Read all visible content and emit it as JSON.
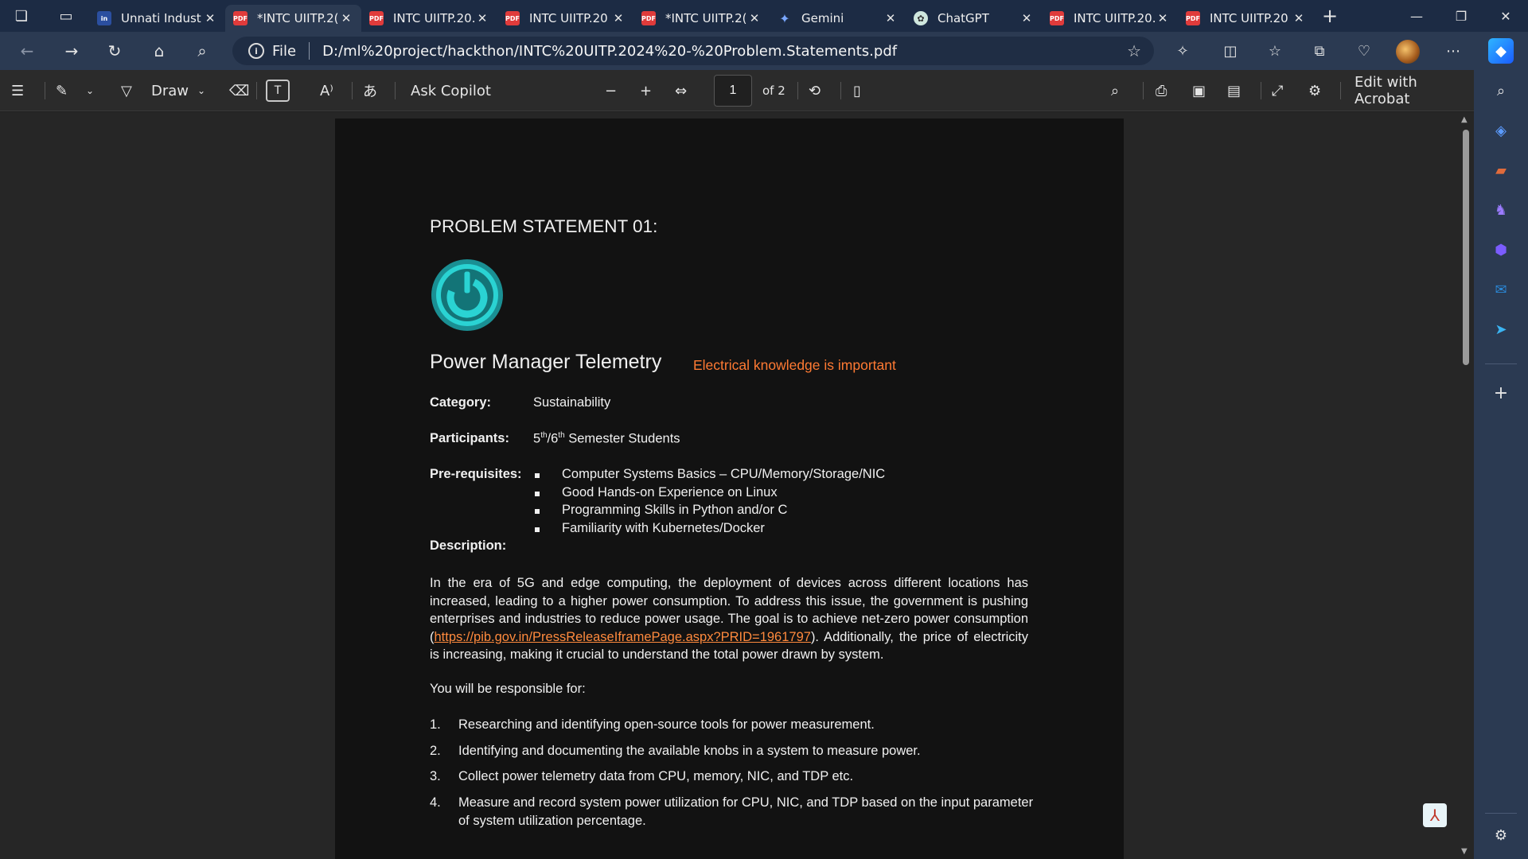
{
  "tabs": [
    {
      "title": "Unnati Indust",
      "favicon": "unnati-icon",
      "active": false
    },
    {
      "title": "*INTC UIITP.2(",
      "favicon": "pdf-icon",
      "active": true
    },
    {
      "title": "INTC UIITP.20.",
      "favicon": "pdf-icon",
      "active": false
    },
    {
      "title": "INTC UIITP.20",
      "favicon": "pdf-icon",
      "active": false
    },
    {
      "title": "*INTC UIITP.2(",
      "favicon": "pdf-icon",
      "active": false
    },
    {
      "title": "Gemini",
      "favicon": "gemini-icon",
      "active": false
    },
    {
      "title": "ChatGPT",
      "favicon": "chatgpt-icon",
      "active": false
    },
    {
      "title": "INTC UIITP.20.",
      "favicon": "pdf-icon",
      "active": false
    },
    {
      "title": "INTC UIITP.20",
      "favicon": "pdf-icon",
      "active": false
    }
  ],
  "address": {
    "scheme_label": "File",
    "url": "D:/ml%20project/hackthon/INTC%20UITP.2024%20-%20Problem.Statements.pdf"
  },
  "pdf_toolbar": {
    "draw_label": "Draw",
    "ask_copilot_label": "Ask Copilot",
    "page_current": "1",
    "page_total_label": "of 2",
    "edit_acrobat_label": "Edit with Acrobat"
  },
  "document": {
    "heading": "PROBLEM STATEMENT 01:",
    "title": "Power Manager Telemetry",
    "annotation": "Electrical knowledge is important",
    "category_label": "Category:",
    "category_value": "Sustainability",
    "participants_label": "Participants:",
    "participants_a": "5",
    "participants_a_sup": "th",
    "participants_b": "/6",
    "participants_b_sup": "th",
    "participants_c": " Semester Students",
    "prereq_label": "Pre-requisites:",
    "prereqs": [
      "Computer Systems Basics – CPU/Memory/Storage/NIC",
      "Good Hands-on Experience on Linux",
      "Programming Skills in Python and/or C",
      "Familiarity with Kubernetes/Docker"
    ],
    "description_label": "Description:",
    "description_line1": "In the era of 5G and edge computing, the deployment of devices across different locations has",
    "description_line2": "increased, leading to a higher power consumption. To address this issue, the government is pushing",
    "description_line3": "enterprises and industries to reduce power usage. The goal is to achieve net-zero power consumption",
    "description_line4_pre": "(",
    "description_link": "https://pib.gov.in/PressReleaseIframePage.aspx?PRID=1961797",
    "description_line4_post": "). Additionally, the price of electricity",
    "description_line5": "is increasing, making it crucial to understand the total power drawn by system.",
    "responsible_label": "You will be responsible for:",
    "tasks": [
      {
        "num": "1.",
        "text": "Researching and identifying open-source tools for power measurement."
      },
      {
        "num": "2.",
        "text": "Identifying and documenting the available knobs in a system to measure power."
      },
      {
        "num": "3.",
        "text": "Collect power telemetry data from CPU, memory, NIC, and TDP etc."
      },
      {
        "num": "4.",
        "text": "Measure and record system power utilization for CPU, NIC, and TDP based on the input parameter"
      }
    ],
    "task4_line2": "of system utilization percentage."
  },
  "colors": {
    "annotation": "#ff7a33",
    "link": "#ff8a3d",
    "logo_teal": "#2ad3d3"
  }
}
